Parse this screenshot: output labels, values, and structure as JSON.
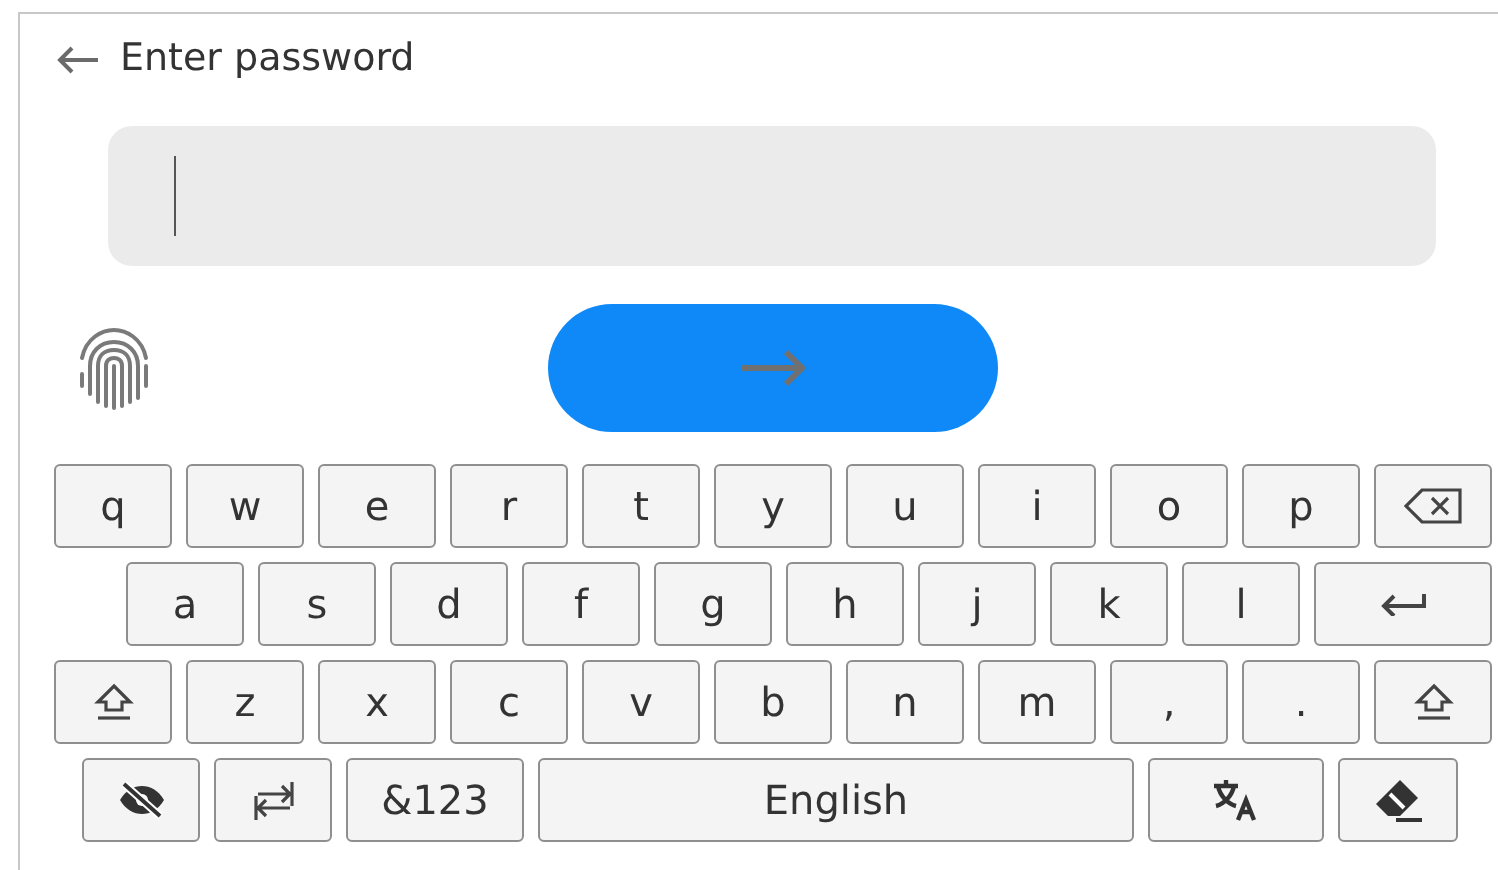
{
  "header": {
    "title": "Enter password"
  },
  "password_field": {
    "focused": true
  },
  "keyboard": {
    "rows": [
      {
        "keys": [
          {
            "kind": "letter",
            "label": "q"
          },
          {
            "kind": "letter",
            "label": "w"
          },
          {
            "kind": "letter",
            "label": "e"
          },
          {
            "kind": "letter",
            "label": "r"
          },
          {
            "kind": "letter",
            "label": "t"
          },
          {
            "kind": "letter",
            "label": "y"
          },
          {
            "kind": "letter",
            "label": "u"
          },
          {
            "kind": "letter",
            "label": "i"
          },
          {
            "kind": "letter",
            "label": "o"
          },
          {
            "kind": "letter",
            "label": "p"
          },
          {
            "kind": "backspace"
          }
        ]
      },
      {
        "keys": [
          {
            "kind": "letter",
            "label": "a"
          },
          {
            "kind": "letter",
            "label": "s"
          },
          {
            "kind": "letter",
            "label": "d"
          },
          {
            "kind": "letter",
            "label": "f"
          },
          {
            "kind": "letter",
            "label": "g"
          },
          {
            "kind": "letter",
            "label": "h"
          },
          {
            "kind": "letter",
            "label": "j"
          },
          {
            "kind": "letter",
            "label": "k"
          },
          {
            "kind": "letter",
            "label": "l"
          },
          {
            "kind": "enter"
          }
        ]
      },
      {
        "keys": [
          {
            "kind": "shift"
          },
          {
            "kind": "letter",
            "label": "z"
          },
          {
            "kind": "letter",
            "label": "x"
          },
          {
            "kind": "letter",
            "label": "c"
          },
          {
            "kind": "letter",
            "label": "v"
          },
          {
            "kind": "letter",
            "label": "b"
          },
          {
            "kind": "letter",
            "label": "n"
          },
          {
            "kind": "letter",
            "label": "m"
          },
          {
            "kind": "letter",
            "label": ","
          },
          {
            "kind": "letter",
            "label": "."
          },
          {
            "kind": "shift"
          }
        ]
      },
      {
        "keys": [
          {
            "kind": "visibility"
          },
          {
            "kind": "swap"
          },
          {
            "kind": "symbols",
            "label": "&123"
          },
          {
            "kind": "space",
            "label": "English"
          },
          {
            "kind": "language"
          },
          {
            "kind": "clear"
          }
        ]
      }
    ]
  }
}
